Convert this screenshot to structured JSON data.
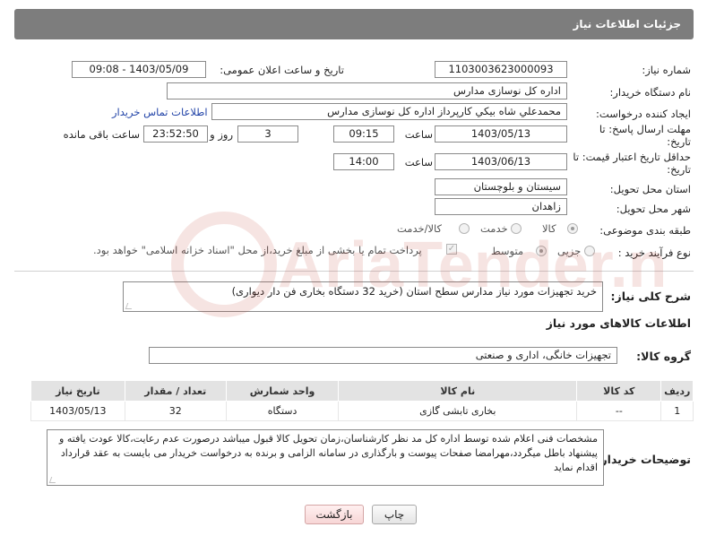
{
  "header": {
    "title": "جزئیات اطلاعات نیاز"
  },
  "fields": {
    "need_number": {
      "label": "شماره نیاز:",
      "value": "1103003623000093"
    },
    "announce_datetime": {
      "label": "تاریخ و ساعت اعلان عمومی:",
      "value": "1403/05/09 - 09:08"
    },
    "buyer_org": {
      "label": "نام دستگاه خریدار:",
      "value": "اداره کل نوسازی مدارس"
    },
    "requester": {
      "label": "ایجاد کننده درخواست:",
      "value": "محمدعلي شاه بيکي کارپرداز اداره کل نوسازی مدارس"
    },
    "buyer_contact_link": "اطلاعات تماس خریدار",
    "reply_deadline": {
      "label_line1": "مهلت ارسال پاسخ: تا",
      "label_line2": "تاریخ:",
      "date": "1403/05/13",
      "time_label": "ساعت",
      "time": "09:15",
      "days": "3",
      "days_label": "روز و",
      "remaining": "23:52:50",
      "remaining_label": "ساعت باقی مانده"
    },
    "price_validity": {
      "label_line1": "حداقل تاریخ اعتبار قیمت: تا",
      "label_line2": "تاریخ:",
      "date": "1403/06/13",
      "time_label": "ساعت",
      "time": "14:00"
    },
    "province": {
      "label": "استان محل تحویل:",
      "value": "سیستان و بلوچستان"
    },
    "city": {
      "label": "شهر محل تحویل:",
      "value": "زاهدان"
    },
    "category": {
      "label": "طبقه بندی موضوعی:",
      "options": [
        "کالا",
        "خدمت",
        "کالا/خدمت"
      ],
      "selected": "کالا"
    },
    "purchase_process": {
      "label": "نوع فرآیند خرید :",
      "options": [
        "جزیی",
        "متوسط"
      ],
      "selected": "متوسط",
      "note": "پرداخت تمام یا بخشی از مبلغ خرید،از محل \"اسناد خزانه اسلامی\" خواهد بود."
    }
  },
  "description": {
    "label": "شرح کلی نیاز:",
    "value": "خرید تجهیزات مورد نیاز مدارس سطح استان (خرید 32 دستگاه بخاری فن دار دیواری)"
  },
  "goods_section_title": "اطلاعات کالاهای مورد نیاز",
  "goods_group": {
    "label": "گروه کالا:",
    "value": "تجهیزات خانگی، اداری و صنعتی"
  },
  "table": {
    "headers": [
      "ردیف",
      "کد کالا",
      "نام کالا",
      "واحد شمارش",
      "تعداد / مقدار",
      "تاریخ نیاز"
    ],
    "rows": [
      [
        "1",
        "--",
        "بخاری تابشی گازی",
        "دستگاه",
        "32",
        "1403/05/13"
      ]
    ]
  },
  "buyer_notes": {
    "label": "توضیحات خریدار:",
    "value": "مشخصات فنی اعلام شده توسط اداره کل مد نظر کارشناسان،زمان تحویل کالا قبول میباشد درصورت عدم رعایت،کالا عودت یافته و پیشنهاد باطل میگردد،مهرامضا صفحات پیوست و بارگذاری در سامانه الزامی و برنده به درخواست خریدار می بایست به عقد قرارداد اقدام نماید"
  },
  "buttons": {
    "print": "چاپ",
    "back": "بازگشت"
  },
  "watermark": {
    "text": "AriaTender.neT"
  },
  "colors": {
    "header_bg": "#7d7d7d",
    "link": "#2345a8",
    "back_button_bg": "#f7d6d6",
    "watermark": "#c0392b"
  }
}
